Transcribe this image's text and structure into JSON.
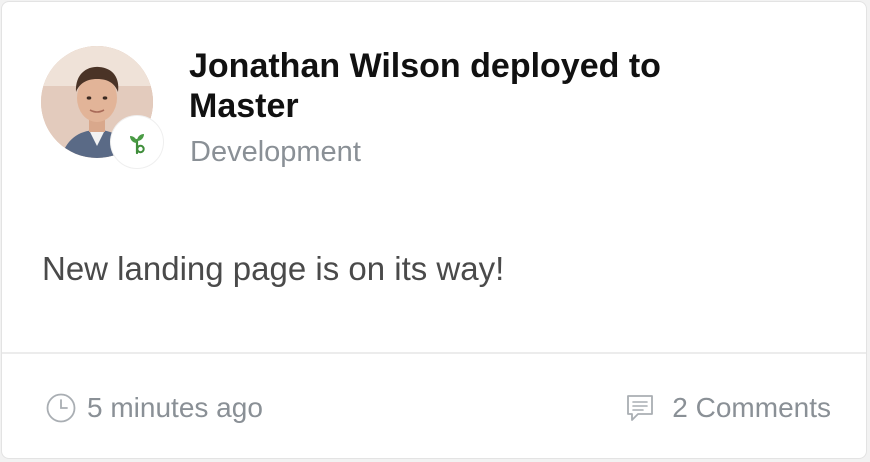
{
  "post": {
    "title": "Jonathan Wilson deployed to Master",
    "project": "Development",
    "message": "New landing page is on its way!",
    "avatar_icon": "user-avatar",
    "badge_icon": "sprout-icon",
    "badge_color": "#3f8d3a"
  },
  "footer": {
    "time": "5 minutes ago",
    "comments": "2 Comments",
    "time_icon": "clock-icon",
    "comments_icon": "comment-icon"
  }
}
